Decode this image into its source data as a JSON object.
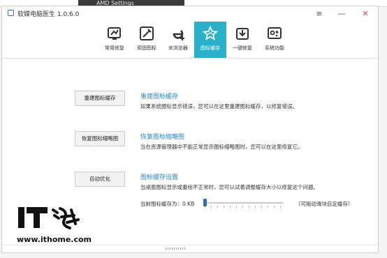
{
  "background_window": {
    "title": "AMD Settings"
  },
  "app": {
    "title": "软媒电脑医生 1.0.6.0"
  },
  "window_controls": {
    "menu": "≡",
    "minimize": "—",
    "close": "✕"
  },
  "toolbar": {
    "items": [
      {
        "label": "常用修复",
        "icon": "common-repair-icon"
      },
      {
        "label": "顽固图标",
        "icon": "stubborn-icon-icon"
      },
      {
        "label": "IE浏览器",
        "icon": "ie-browser-icon"
      },
      {
        "label": "图标缓存",
        "icon": "icon-cache-icon",
        "active": true
      },
      {
        "label": "一键修复",
        "icon": "one-click-repair-icon"
      },
      {
        "label": "系统功能",
        "icon": "system-function-icon"
      }
    ]
  },
  "sections": [
    {
      "button": "重建图标缓存",
      "title": "重建图标缓存",
      "desc": "如果系统图标显示错误，您可以在这里重建图标缓存，以修复错误。"
    },
    {
      "button": "恢复图标缩略图",
      "title": "恢复图标缩略图",
      "desc": "当在资源管理器中不能正常显示图标缩略图时，您可以在这里修复它。"
    },
    {
      "button": "自动优化",
      "title": "图标缓存设置",
      "desc": "当桌面图标显示或重绘不正常时，您可以试着调整缓存大小以修复这个问题。"
    }
  ],
  "cache_slider": {
    "label": "当前图标缓存为：0 KB",
    "hint": "（可拖动滑块自定缓存）",
    "value_fraction": 0
  },
  "watermark": {
    "brand": "IT之家",
    "url": "www.ithome.com"
  },
  "colors": {
    "accent": "#2ab0c9",
    "link": "#2b88c8",
    "close": "#e04040"
  }
}
